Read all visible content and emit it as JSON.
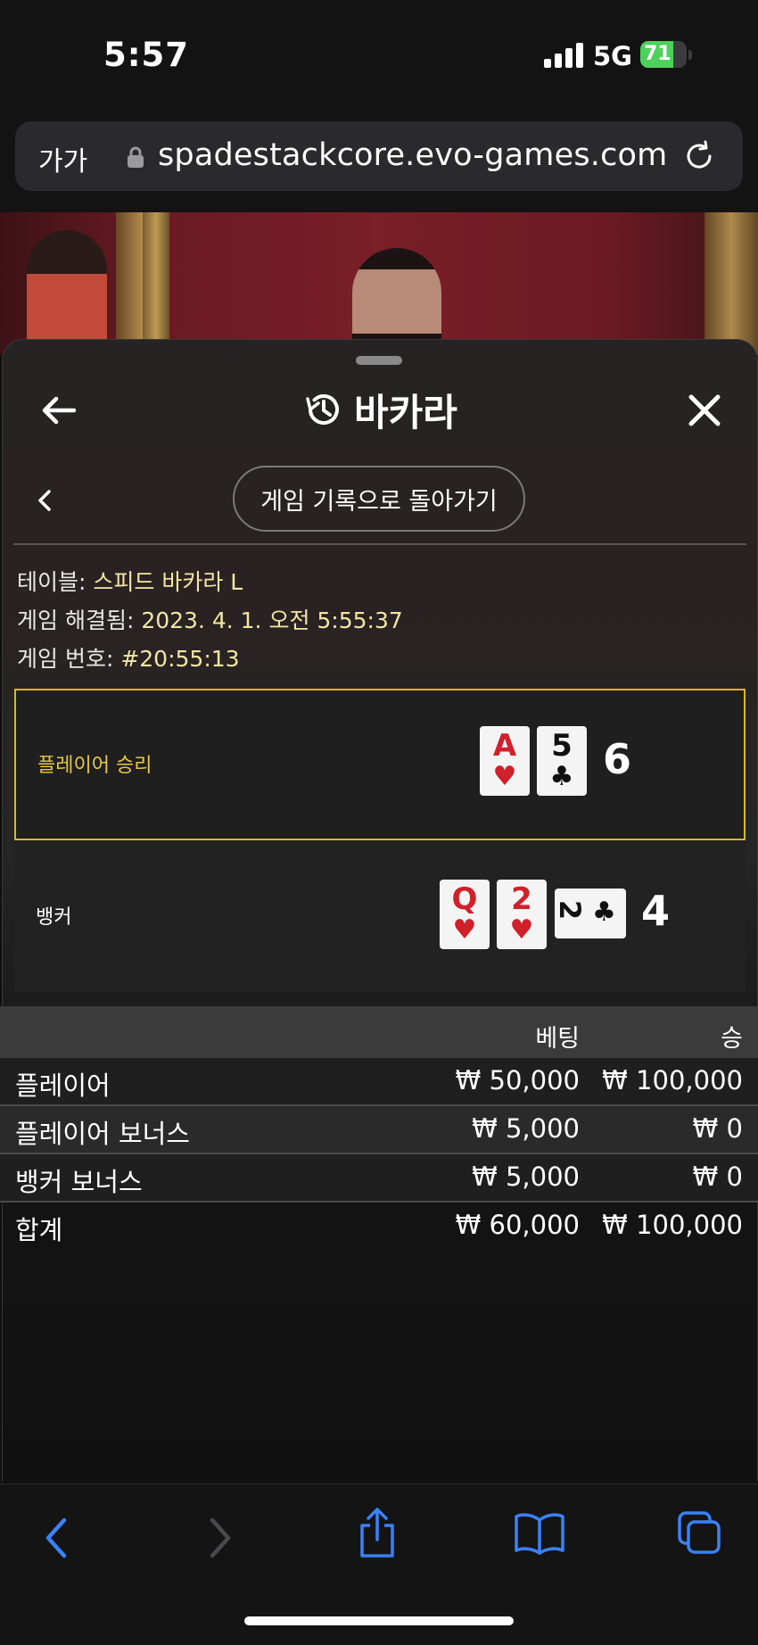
{
  "status_bar": {
    "time": "5:57",
    "network": "5G",
    "battery": "71",
    "battery_level": 0.71
  },
  "browser": {
    "text_size_label": "가가",
    "url": "spadestackcore.evo-games.com"
  },
  "panel": {
    "title": "바카라",
    "back_to_history_label": "게임 기록으로 돌아가기",
    "info": {
      "table_label": "테이블:",
      "table_value": "스피드 바카라 L",
      "resolved_label": "게임 해결됨:",
      "resolved_value": "2023. 4. 1. 오전 5:55:37",
      "game_no_label": "게임 번호:",
      "game_no_value": "#20:55:13"
    },
    "player": {
      "label": "플레이어 승리",
      "score": "6",
      "cards": [
        {
          "rank": "A",
          "suit": "♥"
        },
        {
          "rank": "5",
          "suit": "♣"
        }
      ]
    },
    "banker": {
      "label": "뱅커",
      "score": "4",
      "cards": [
        {
          "rank": "Q",
          "suit": "♥"
        },
        {
          "rank": "2",
          "suit": "♥"
        },
        {
          "rank": "2",
          "suit": "♣"
        }
      ]
    },
    "bets": {
      "headers": {
        "bet": "베팅",
        "win": "승"
      },
      "rows": [
        {
          "name": "플레이어",
          "bet": "₩ 50,000",
          "win": "₩ 100,000"
        },
        {
          "name": "플레이어 보너스",
          "bet": "₩ 5,000",
          "win": "₩ 0"
        },
        {
          "name": "뱅커 보너스",
          "bet": "₩ 5,000",
          "win": "₩ 0"
        }
      ],
      "total": {
        "name": "합계",
        "bet": "₩ 60,000",
        "win": "₩ 100,000"
      }
    }
  },
  "colors": {
    "win_highlight": "#d9b82c",
    "safari_blue": "#3a82f7",
    "battery_green": "#4cd15a"
  }
}
